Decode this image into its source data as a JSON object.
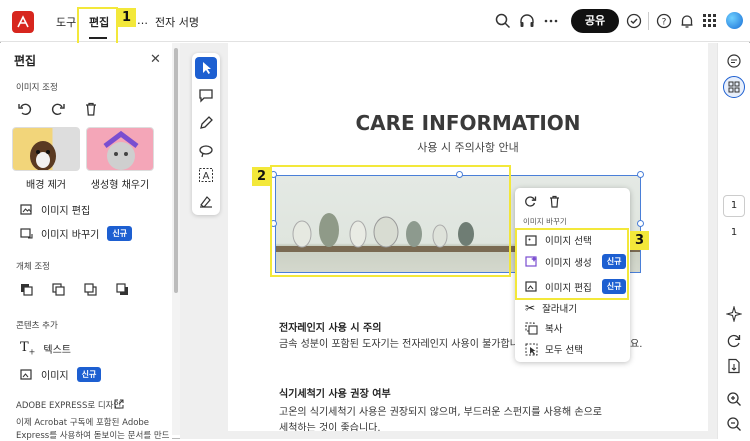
{
  "topbar": {
    "menu": [
      "도구",
      "편집",
      "…",
      "전자 서명"
    ],
    "share_label": "공유"
  },
  "callouts": [
    "1",
    "2",
    "3"
  ],
  "panel": {
    "title": "편집",
    "section_image_adjust": "이미지 조정",
    "thumb_labels": [
      "배경 제거",
      "생성형 채우기"
    ],
    "edit_image": "이미지 편집",
    "replace_image": "이미지 바꾸기",
    "new_badge": "신규",
    "section_object": "개체 조정",
    "section_add": "콘텐츠 추가",
    "text": "텍스트",
    "image": "이미지",
    "express_title": "ADOBE EXPRESS로 디자인",
    "express_desc_1": "이제 Acrobat 구독에 포함된 Adobe",
    "express_desc_2": "Express를 사용하여 돋보이는 문서를 만드"
  },
  "document": {
    "heading": "CARE INFORMATION",
    "subheading": "사용 시 주의사항 안내",
    "s1_title": "전자레인지 사용 시 주의",
    "s1_text_a": "금속 성분이 포함된 도자기는 전자레인지 사용이 불가합니",
    "s1_text_b": "요.",
    "s2_title": "식기세척기 사용 권장 여부",
    "s2_text_1": "고온의 식기세척기 사용은 권장되지 않으며, 부드러운 스펀지를 사용해 손으로",
    "s2_text_2": "세척하는 것이 좋습니다."
  },
  "context_menu": {
    "section": "이미지 바꾸기",
    "select_image": "이미지 선택",
    "generate_image": "이미지 생성",
    "edit_image": "이미지 편집",
    "new_badge": "신규",
    "cut": "잘라내기",
    "copy": "복사",
    "select_all": "모두 선택"
  },
  "rail": {
    "page_current": "1",
    "page_total": "1"
  },
  "colors": {
    "accent": "#1d5fd1",
    "highlight": "#f3e83a",
    "brand": "#d7261e"
  }
}
